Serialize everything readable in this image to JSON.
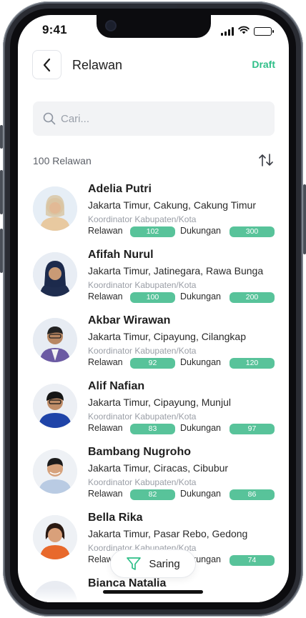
{
  "status": {
    "time": "9:41"
  },
  "header": {
    "title": "Relawan",
    "draft_label": "Draft",
    "back_icon": "chevron-left-icon"
  },
  "search": {
    "placeholder": "Cari..."
  },
  "summary": {
    "count_label": "100 Relawan"
  },
  "list": {
    "items": [
      {
        "name": "Adelia Putri",
        "location": "Jakarta Timur, Cakung, Cakung Timur",
        "role": "Koordinator Kabupaten/Kota",
        "relawan_label": "Relawan",
        "relawan": "102",
        "dukungan_label": "Dukungan",
        "dukungan": "300"
      },
      {
        "name": "Afifah Nurul",
        "location": "Jakarta Timur, Jatinegara, Rawa Bunga",
        "role": "Koordinator Kabupaten/Kota",
        "relawan_label": "Relawan",
        "relawan": "100",
        "dukungan_label": "Dukungan",
        "dukungan": "200"
      },
      {
        "name": "Akbar Wirawan",
        "location": "Jakarta Timur, Cipayung, Cilangkap",
        "role": "Koordinator Kabupaten/Kota",
        "relawan_label": "Relawan",
        "relawan": "92",
        "dukungan_label": "Dukungan",
        "dukungan": "120"
      },
      {
        "name": "Alif Nafian",
        "location": "Jakarta Timur, Cipayung, Munjul",
        "role": "Koordinator Kabupaten/Kota",
        "relawan_label": "Relawan",
        "relawan": "83",
        "dukungan_label": "Dukungan",
        "dukungan": "97"
      },
      {
        "name": "Bambang Nugroho",
        "location": "Jakarta Timur, Ciracas, Cibubur",
        "role": "Koordinator Kabupaten/Kota",
        "relawan_label": "Relawan",
        "relawan": "82",
        "dukungan_label": "Dukungan",
        "dukungan": "86"
      },
      {
        "name": "Bella Rika",
        "location": "Jakarta Timur, Pasar Rebo, Gedong",
        "role": "Koordinator Kabupaten/Kota",
        "relawan_label": "Relawan",
        "relawan": "",
        "dukungan_label": "Dukungan",
        "dukungan": "74"
      },
      {
        "name": "Bianca Natalia",
        "location": "",
        "role": "",
        "relawan_label": "",
        "relawan": "",
        "dukungan_label": "",
        "dukungan": ""
      }
    ]
  },
  "filter": {
    "label": "Saring",
    "icon": "filter-icon"
  },
  "colors": {
    "accent": "#58c39a",
    "draft": "#2fbf88",
    "search_bg": "#f2f3f5"
  }
}
